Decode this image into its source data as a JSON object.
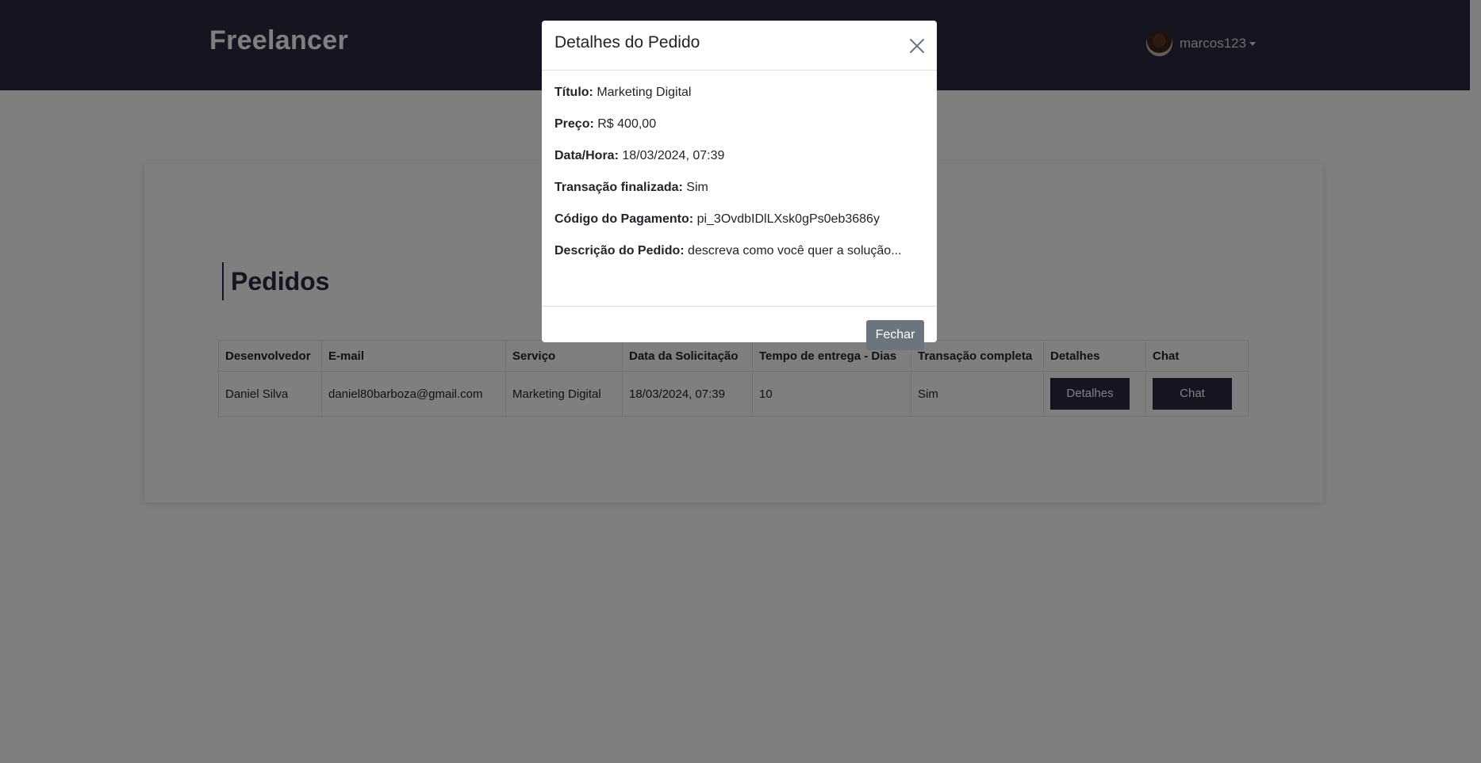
{
  "navbar": {
    "brand": "Freelancer",
    "username": "marcos123"
  },
  "main": {
    "title": "Pedidos",
    "table": {
      "headers": [
        "Desenvolvedor",
        "E-mail",
        "Serviço",
        "Data da Solicitação",
        "Tempo de entrega - Dias",
        "Transação completa",
        "Detalhes",
        "Chat"
      ],
      "rows": [
        {
          "developer": "Daniel Silva",
          "email": "daniel80barboza@gmail.com",
          "service": "Marketing Digital",
          "date": "18/03/2024, 07:39",
          "delivery_days": "10",
          "complete": "Sim",
          "details_label": "Detalhes",
          "chat_label": "Chat"
        }
      ]
    }
  },
  "modal": {
    "title": "Detalhes do Pedido",
    "fields": [
      {
        "label": "Título:",
        "value": "Marketing Digital"
      },
      {
        "label": "Preço:",
        "value": "R$ 400,00"
      },
      {
        "label": "Data/Hora:",
        "value": "18/03/2024, 07:39"
      },
      {
        "label": "Transação finalizada:",
        "value": "Sim"
      },
      {
        "label": "Código do Pagamento:",
        "value": "pi_3OvdbIDlLXsk0gPs0eb3686y"
      },
      {
        "label": "Descrição do Pedido:",
        "value": "descreva como você quer a solução..."
      }
    ],
    "close_label": "Fechar"
  },
  "colors": {
    "navbar": "#2b2842",
    "accent_button": "#2b2842",
    "secondary_button": "#6c757d"
  }
}
